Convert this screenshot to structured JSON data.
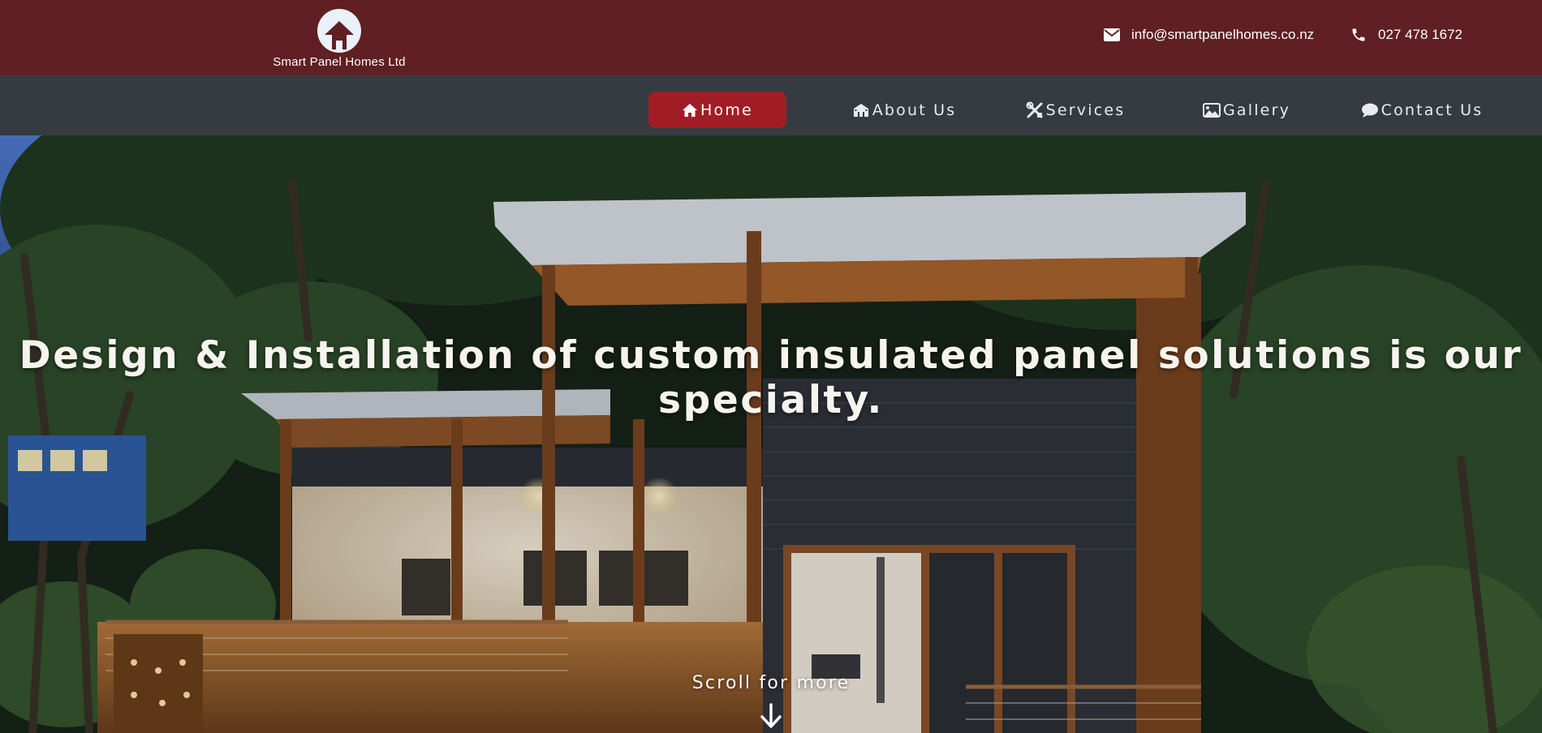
{
  "brand": {
    "name": "Smart Panel Homes Ltd",
    "logo_icon": "house-in-circle-icon"
  },
  "contact": {
    "email": "info@smartpanelhomes.co.nz",
    "email_icon": "envelope-icon",
    "phone": "027 478 1672",
    "phone_icon": "phone-icon"
  },
  "nav": {
    "items": [
      {
        "label": "Home",
        "icon": "home-icon",
        "active": true
      },
      {
        "label": "About Us",
        "icon": "building-icon",
        "active": false
      },
      {
        "label": "Services",
        "icon": "tools-icon",
        "active": false
      },
      {
        "label": "Gallery",
        "icon": "image-icon",
        "active": false
      },
      {
        "label": "Contact Us",
        "icon": "chat-bubble-icon",
        "active": false
      }
    ]
  },
  "hero": {
    "headline": "Design & Installation of custom insulated panel solutions is our specialty.",
    "scroll_label": "Scroll for more",
    "scroll_icon": "arrow-down-icon"
  },
  "colors": {
    "topbar": "#601f22",
    "nav_bg": "#363b42",
    "nav_active": "#a11d26",
    "text_light": "#ffffff"
  }
}
